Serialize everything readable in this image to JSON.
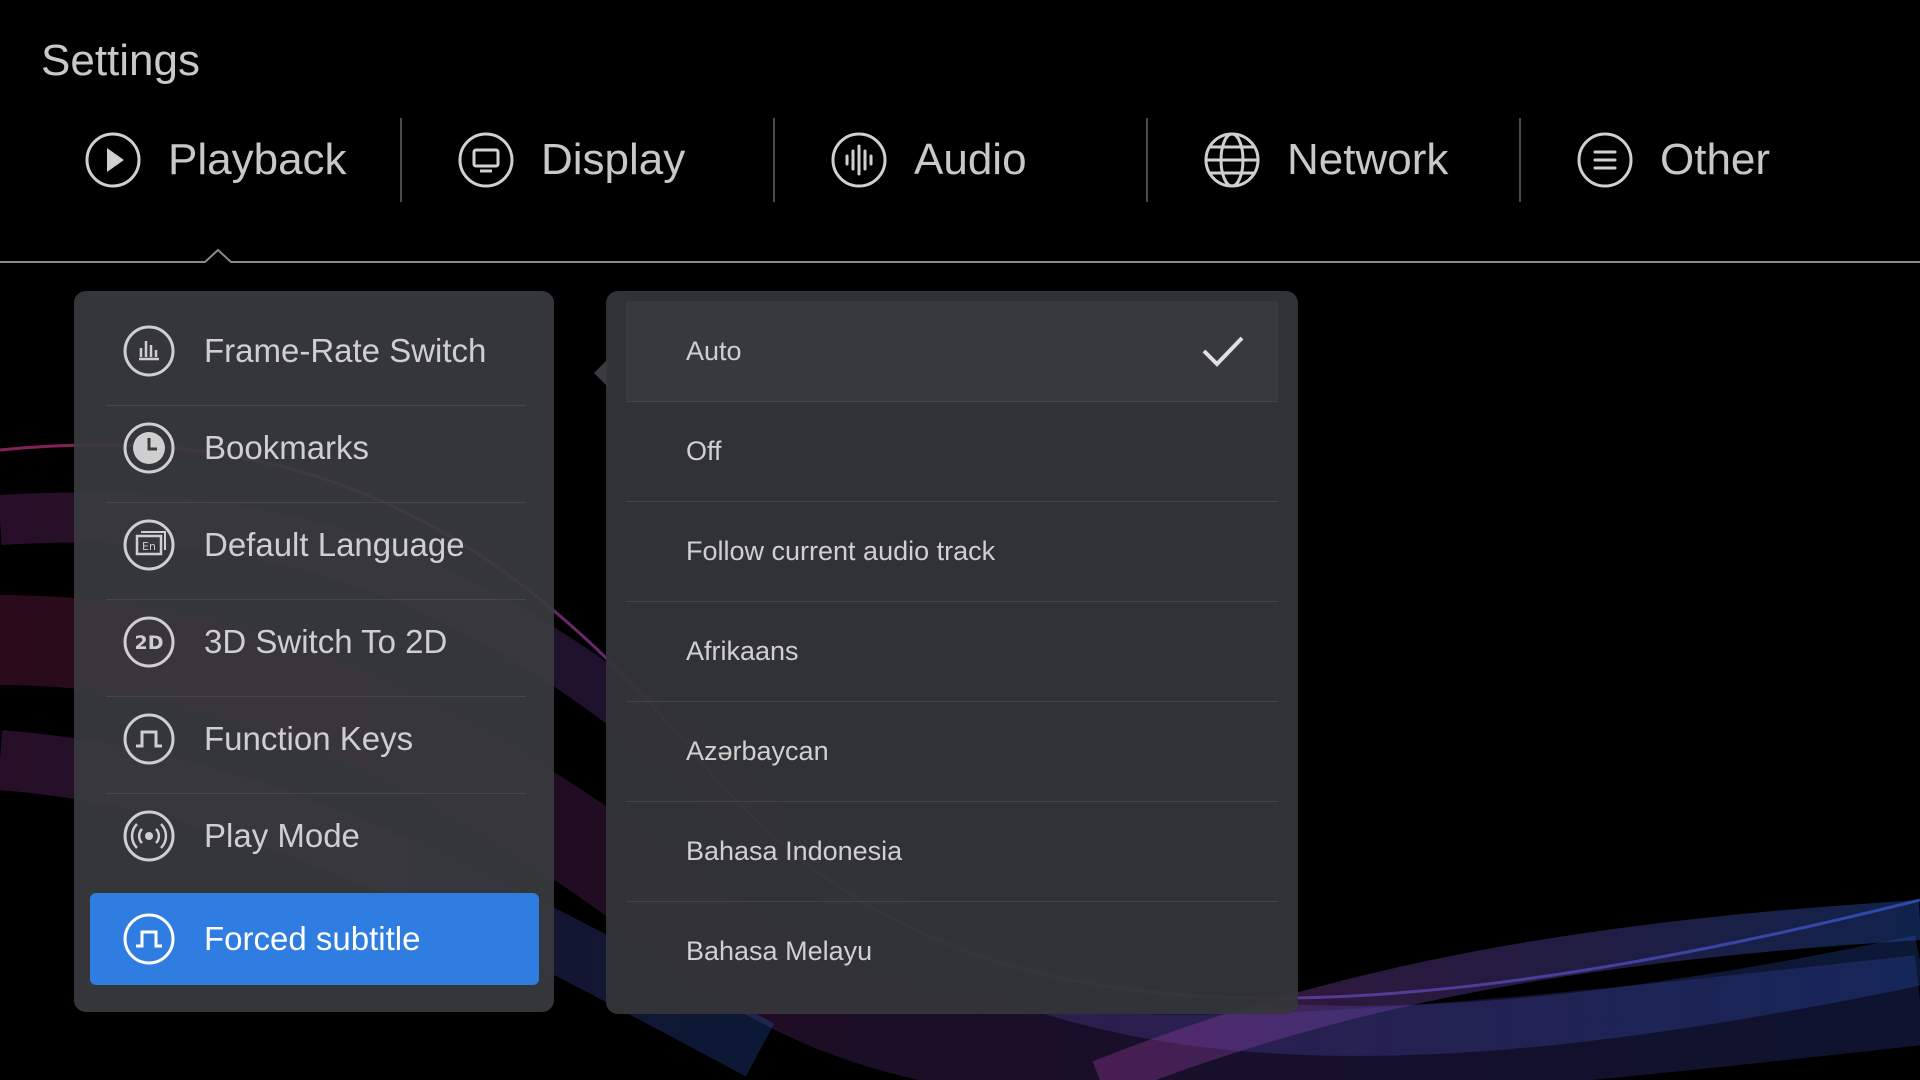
{
  "page": {
    "title": "Settings"
  },
  "tabs": [
    {
      "label": "Playback",
      "icon": "play-icon",
      "active": true
    },
    {
      "label": "Display",
      "icon": "monitor-icon"
    },
    {
      "label": "Audio",
      "icon": "sound-wave-icon"
    },
    {
      "label": "Network",
      "icon": "globe-icon"
    },
    {
      "label": "Other",
      "icon": "list-icon"
    }
  ],
  "menu": {
    "items": [
      {
        "label": "Frame-Rate Switch",
        "icon": "bar-chart-icon"
      },
      {
        "label": "Bookmarks",
        "icon": "clock-icon"
      },
      {
        "label": "Default Language",
        "icon": "language-en-icon"
      },
      {
        "label": "3D Switch To 2D",
        "icon": "2d-icon"
      },
      {
        "label": "Function Keys",
        "icon": "pulse-wave-icon"
      },
      {
        "label": "Play Mode",
        "icon": "broadcast-icon"
      },
      {
        "label": "Forced subtitle",
        "icon": "pulse-wave-icon",
        "selected": true
      }
    ]
  },
  "options": {
    "items": [
      {
        "label": "Auto",
        "checked": true
      },
      {
        "label": "Off"
      },
      {
        "label": "Follow current audio track"
      },
      {
        "label": "Afrikaans"
      },
      {
        "label": "Azərbaycan"
      },
      {
        "label": "Bahasa Indonesia"
      },
      {
        "label": "Bahasa Melayu"
      }
    ],
    "checked_icon": "checkmark-icon"
  },
  "colors": {
    "accent": "#2f7de1",
    "background": "#000000",
    "panel": "#3a3b3f"
  }
}
